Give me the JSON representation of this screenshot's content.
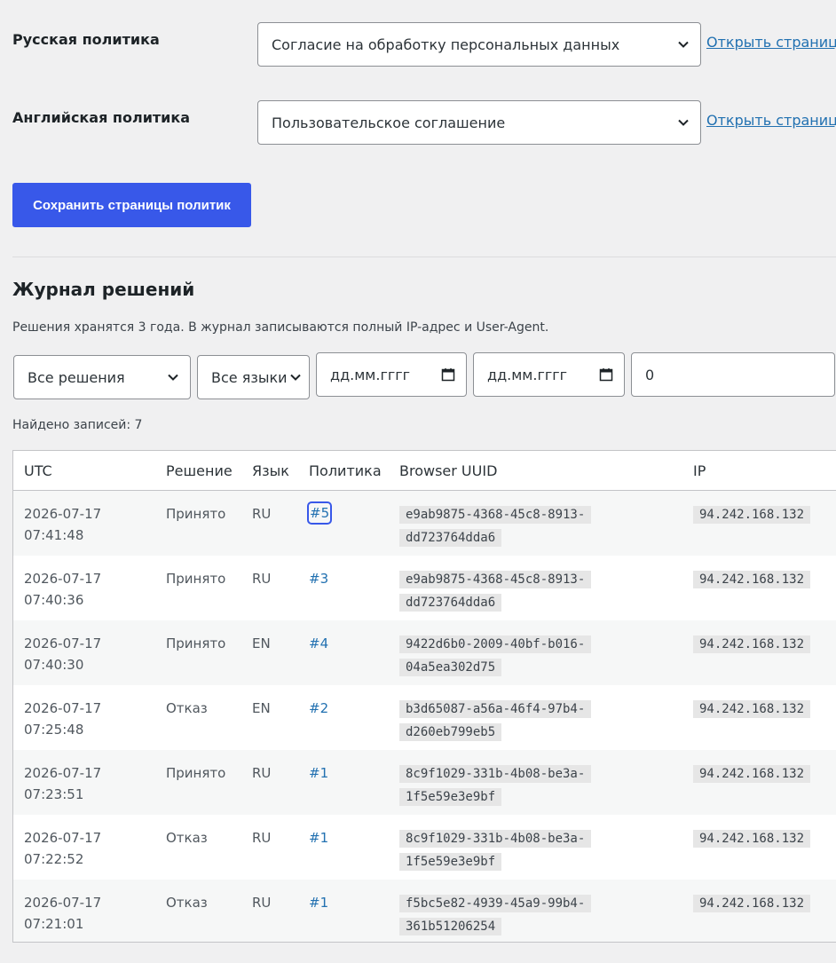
{
  "policies": {
    "ru": {
      "label": "Русская политика",
      "selected": "Согласие на обработку персональных данных",
      "link": "Открыть страницу"
    },
    "en": {
      "label": "Английская политика",
      "selected": "Пользовательское соглашение",
      "link": "Открыть страницу"
    },
    "save_label": "Сохранить страницы политик"
  },
  "journal": {
    "title": "Журнал решений",
    "note": "Решения хранятся 3 года. В журнал записываются полный IP-адрес и User-Agent.",
    "filters": {
      "decision": "Все решения",
      "language": "Все языки",
      "date_from": "дд.мм.гггг",
      "date_to": "дд.мм.гггг",
      "policy_id": "0"
    },
    "found": "Найдено записей: 7",
    "columns": [
      "UTC",
      "Решение",
      "Язык",
      "Политика",
      "Browser UUID",
      "IP"
    ],
    "rows": [
      {
        "date": "2026-07-17",
        "time": "07:41:48",
        "decision": "Принято",
        "lang": "RU",
        "policy": "#5",
        "uuid1": "e9ab9875-4368-45c8-8913-",
        "uuid2": "dd723764dda6",
        "ip": "94.242.168.132"
      },
      {
        "date": "2026-07-17",
        "time": "07:40:36",
        "decision": "Принято",
        "lang": "RU",
        "policy": "#3",
        "uuid1": "e9ab9875-4368-45c8-8913-",
        "uuid2": "dd723764dda6",
        "ip": "94.242.168.132"
      },
      {
        "date": "2026-07-17",
        "time": "07:40:30",
        "decision": "Принято",
        "lang": "EN",
        "policy": "#4",
        "uuid1": "9422d6b0-2009-40bf-b016-",
        "uuid2": "04a5ea302d75",
        "ip": "94.242.168.132"
      },
      {
        "date": "2026-07-17",
        "time": "07:25:48",
        "decision": "Отказ",
        "lang": "EN",
        "policy": "#2",
        "uuid1": "b3d65087-a56a-46f4-97b4-",
        "uuid2": "d260eb799eb5",
        "ip": "94.242.168.132"
      },
      {
        "date": "2026-07-17",
        "time": "07:23:51",
        "decision": "Принято",
        "lang": "RU",
        "policy": "#1",
        "uuid1": "8c9f1029-331b-4b08-be3a-",
        "uuid2": "1f5e59e3e9bf",
        "ip": "94.242.168.132"
      },
      {
        "date": "2026-07-17",
        "time": "07:22:52",
        "decision": "Отказ",
        "lang": "RU",
        "policy": "#1",
        "uuid1": "8c9f1029-331b-4b08-be3a-",
        "uuid2": "1f5e59e3e9bf",
        "ip": "94.242.168.132"
      },
      {
        "date": "2026-07-17",
        "time": "07:21:01",
        "decision": "Отказ",
        "lang": "RU",
        "policy": "#1",
        "uuid1": "f5bc5e82-4939-45a9-99b4-",
        "uuid2": "361b51206254",
        "ip": "94.242.168.132"
      }
    ]
  }
}
